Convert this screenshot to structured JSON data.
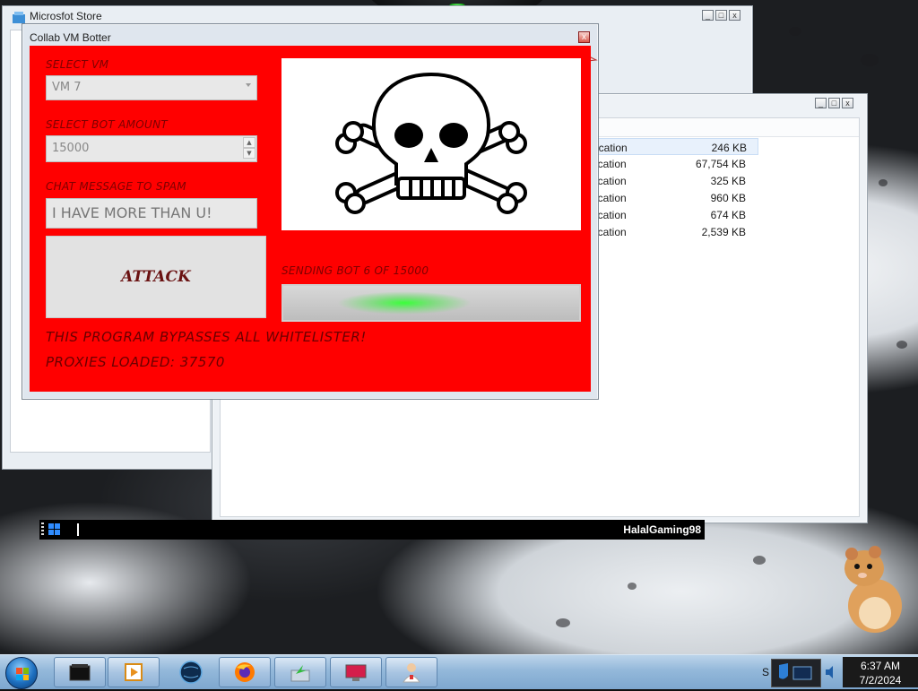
{
  "store_window": {
    "title": "Microsfot Store"
  },
  "files_window": {
    "rows": [
      {
        "type": "ication",
        "size": "246 KB"
      },
      {
        "type": "ication",
        "size": "67,754 KB"
      },
      {
        "type": "ication",
        "size": "325 KB"
      },
      {
        "type": "ication",
        "size": "960 KB"
      },
      {
        "type": "ication",
        "size": "674 KB"
      },
      {
        "type": "ication",
        "size": "2,539 KB"
      }
    ]
  },
  "vm_taskbar": {
    "username": "HalalGaming98"
  },
  "botter": {
    "title": "Collab VM Botter",
    "select_vm_label": "SELECT VM",
    "select_vm_value": "VM 7",
    "bot_amount_label": "SELECT BOT AMOUNT",
    "bot_amount_value": "15000",
    "chat_label": "CHAT MESSAGE TO SPAM",
    "chat_value": "I HAVE MORE THAN U!",
    "attack_label": "ATTACK",
    "progress_label": "SENDING BOT 6 OF 15000",
    "progress_fraction": 0.0004,
    "bypass_text": "THIS PROGRAM BYPASSES ALL WHITELISTER!",
    "proxies_text": "PROXIES LOADED: 37570"
  },
  "taskbar": {
    "items": [
      "app-icon",
      "media-player-icon",
      "globe-icon",
      "firefox-icon",
      "green-arrow-icon",
      "red-monitor-icon",
      "doctor-icon"
    ],
    "tray_letter": "S",
    "time": "6:37 AM",
    "date": "7/2/2024"
  },
  "colors": {
    "botter_panel": "#ff0000",
    "taskbar": "#93b8da"
  }
}
